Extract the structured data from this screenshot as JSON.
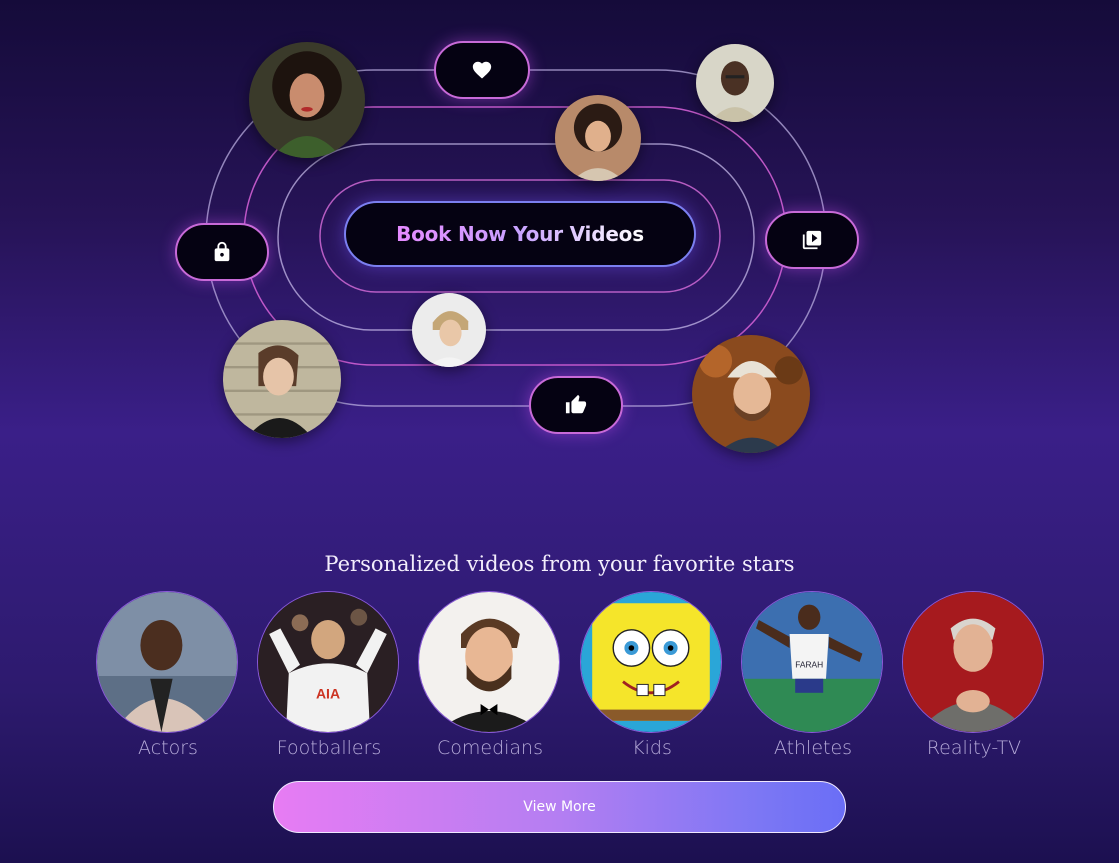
{
  "hero": {
    "cta_label": "Book Now Your Videos",
    "icons": [
      "heart-icon",
      "lock-icon",
      "play-video-icon",
      "thumbs-up-icon"
    ]
  },
  "section": {
    "title": "Personalized videos from your favorite stars"
  },
  "categories": [
    {
      "label": "Actors"
    },
    {
      "label": "Footballers"
    },
    {
      "label": "Comedians"
    },
    {
      "label": "Kids"
    },
    {
      "label": "Athletes"
    },
    {
      "label": "Reality-TV"
    }
  ],
  "view_more_label": "View More",
  "colors": {
    "accent_pink": "#e77cf3",
    "accent_blue": "#6a6ef6",
    "background": "#2d1a6e"
  }
}
